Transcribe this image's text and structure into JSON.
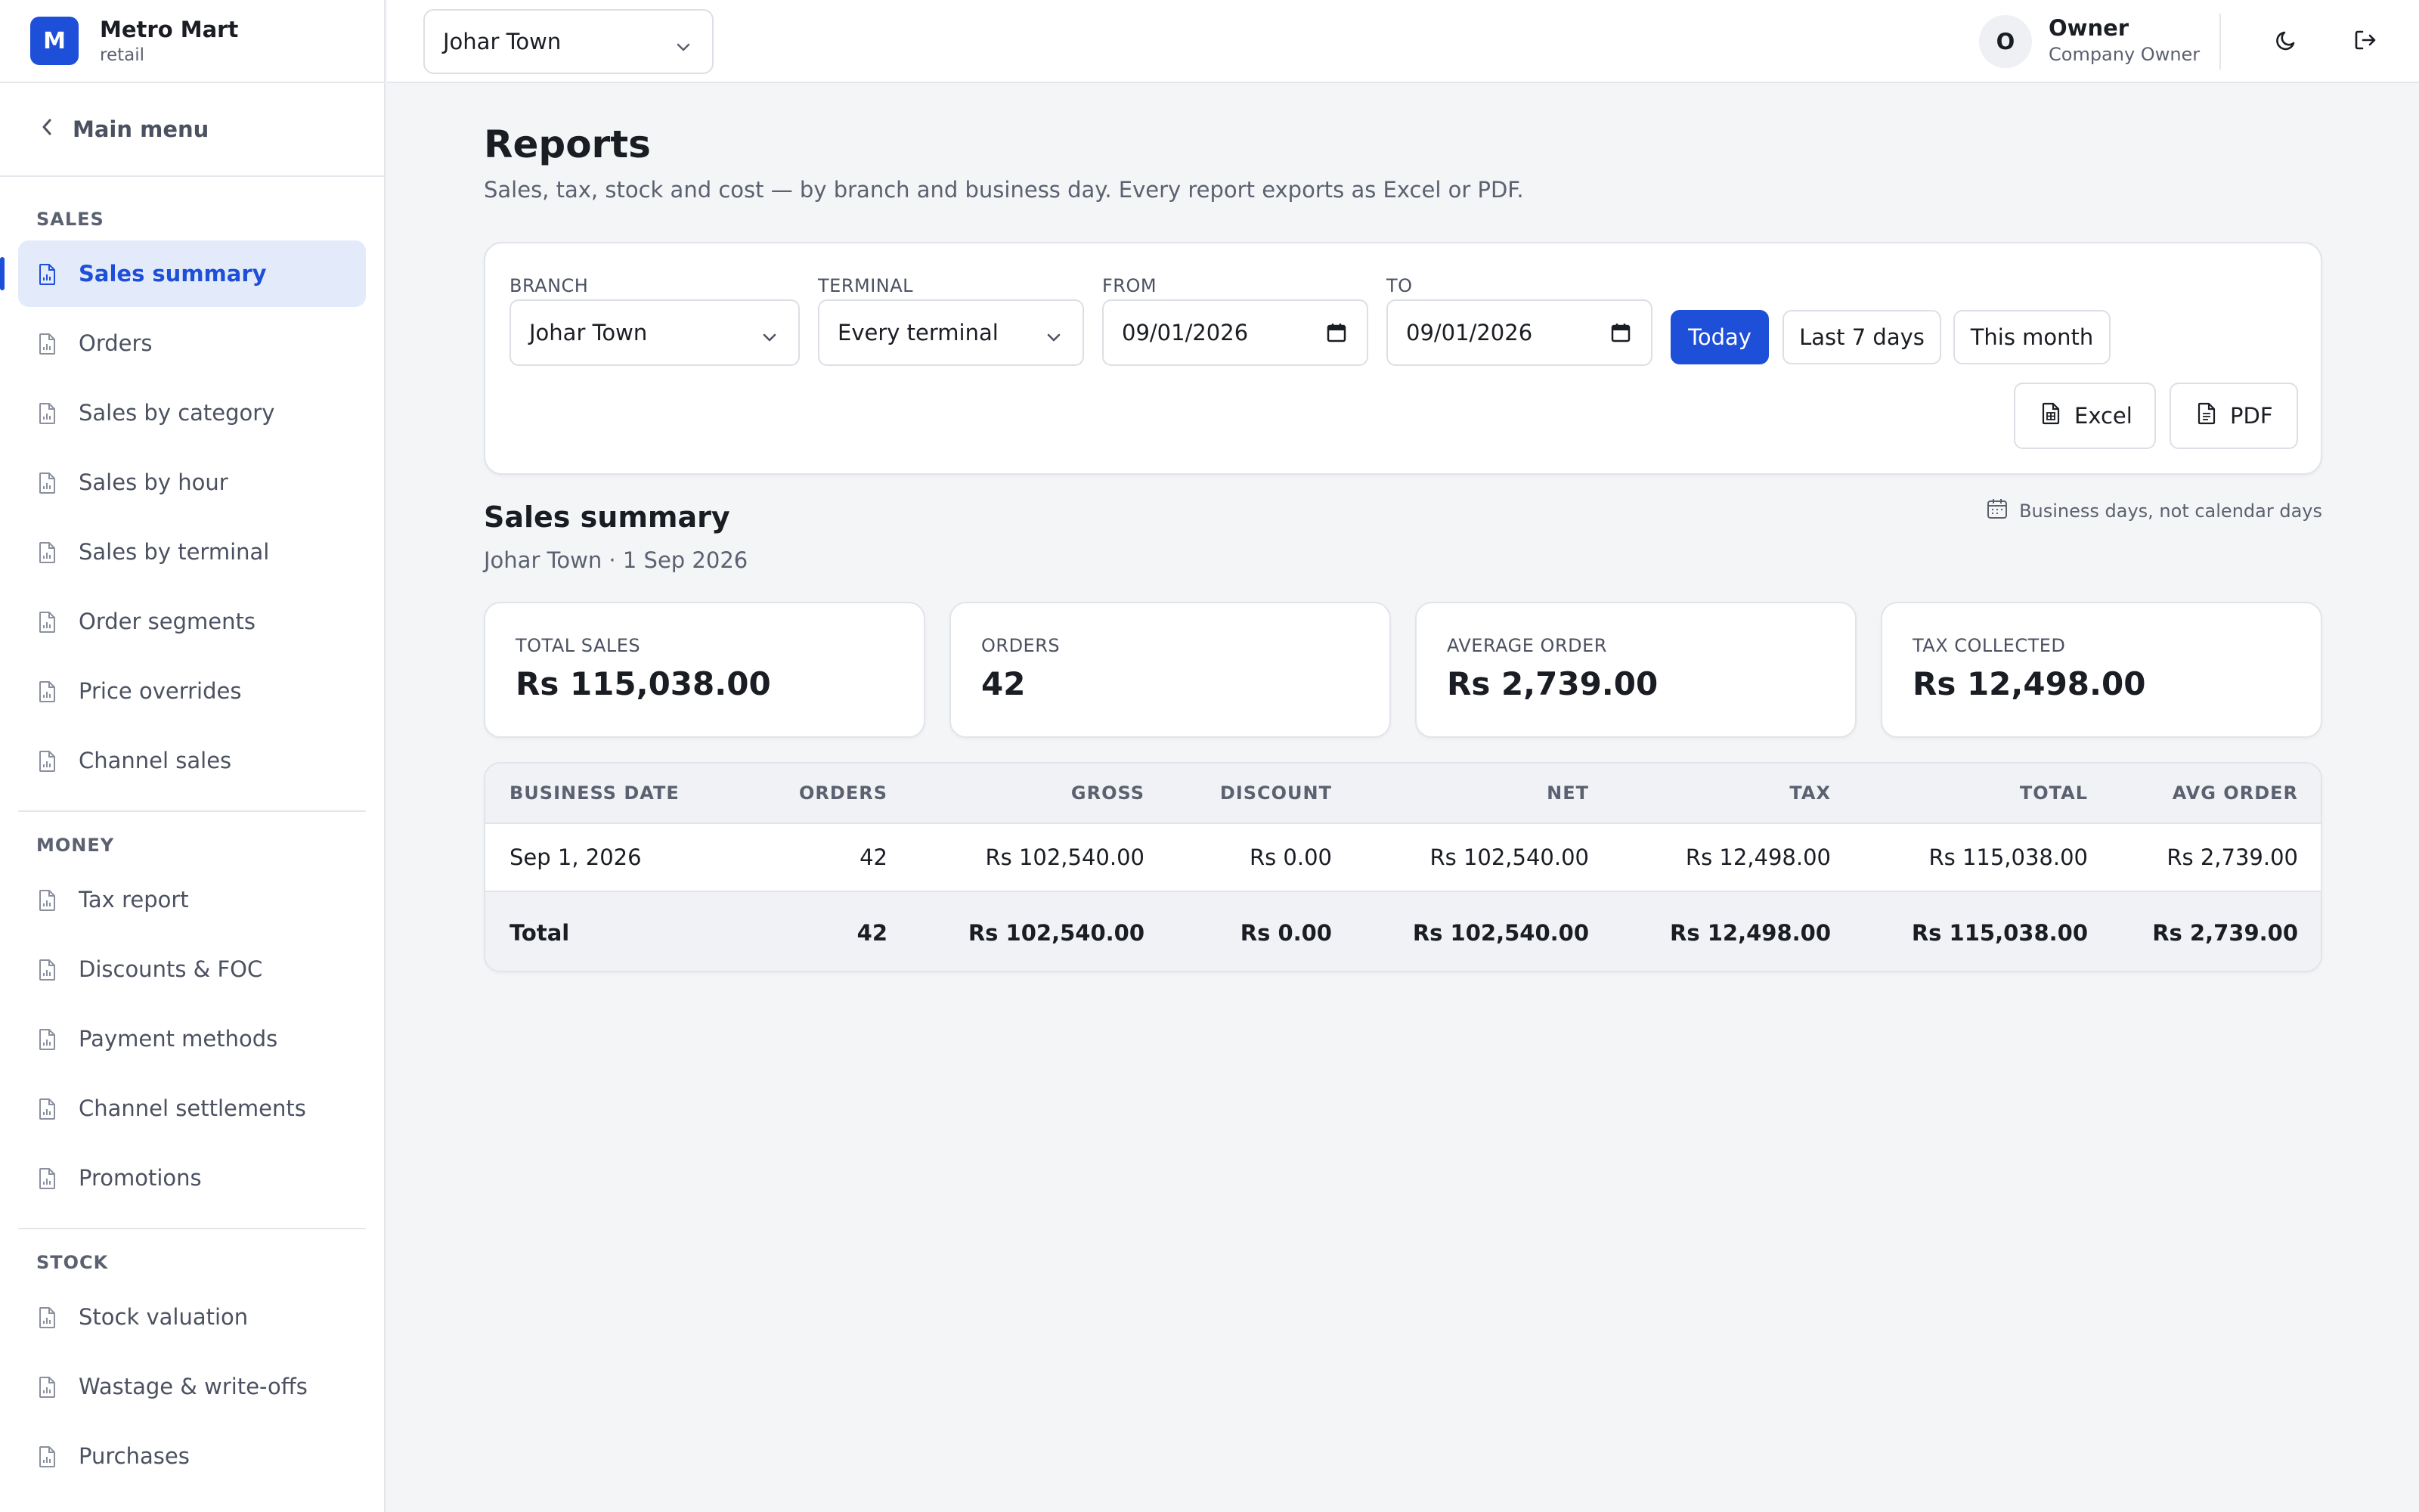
{
  "brand": {
    "logo_letter": "M",
    "name": "Metro Mart",
    "type": "retail"
  },
  "topbar": {
    "branch": "Johar Town",
    "user_initial": "O",
    "user_name": "Owner",
    "user_role": "Company Owner",
    "icons": [
      "moon-icon",
      "logout-icon"
    ]
  },
  "sidebar": {
    "back_label": "Main menu",
    "sections": [
      {
        "title": "SALES",
        "items": [
          "Sales summary",
          "Orders",
          "Sales by category",
          "Sales by hour",
          "Sales by terminal",
          "Order segments",
          "Price overrides",
          "Channel sales"
        ]
      },
      {
        "title": "MONEY",
        "items": [
          "Tax report",
          "Discounts & FOC",
          "Payment methods",
          "Channel settlements",
          "Promotions"
        ]
      },
      {
        "title": "STOCK",
        "items": [
          "Stock valuation",
          "Wastage & write-offs",
          "Purchases"
        ]
      }
    ],
    "active_item": "Sales summary"
  },
  "page": {
    "title": "Reports",
    "subtitle": "Sales, tax, stock and cost — by branch and business day. Every report exports as Excel or PDF."
  },
  "filters": {
    "branch_label": "BRANCH",
    "branch_value": "Johar Town",
    "terminal_label": "TERMINAL",
    "terminal_value": "Every terminal",
    "from_label": "FROM",
    "from_value": "09/01/2026",
    "to_label": "TO",
    "to_value": "09/01/2026",
    "quick_ranges": [
      "Today",
      "Last 7 days",
      "This month"
    ],
    "active_range": "Today",
    "export_excel": "Excel",
    "export_pdf": "PDF"
  },
  "report": {
    "title": "Sales summary",
    "subtitle": "Johar Town · 1 Sep 2026",
    "note": "Business days, not calendar days"
  },
  "stats": [
    {
      "label": "TOTAL SALES",
      "value": "Rs 115,038.00"
    },
    {
      "label": "ORDERS",
      "value": "42"
    },
    {
      "label": "AVERAGE ORDER",
      "value": "Rs 2,739.00"
    },
    {
      "label": "TAX COLLECTED",
      "value": "Rs 12,498.00"
    }
  ],
  "table": {
    "headers": [
      "BUSINESS DATE",
      "ORDERS",
      "GROSS",
      "DISCOUNT",
      "NET",
      "TAX",
      "TOTAL",
      "AVG ORDER"
    ],
    "rows": [
      [
        "Sep 1, 2026",
        "42",
        "Rs 102,540.00",
        "Rs 0.00",
        "Rs 102,540.00",
        "Rs 12,498.00",
        "Rs 115,038.00",
        "Rs 2,739.00"
      ]
    ],
    "footer": [
      "Total",
      "42",
      "Rs 102,540.00",
      "Rs 0.00",
      "Rs 102,540.00",
      "Rs 12,498.00",
      "Rs 115,038.00",
      "Rs 2,739.00"
    ]
  },
  "colors": {
    "accent": "#1d4fd8",
    "active_bg": "#e3ebfb",
    "page_bg": "#f4f5f7"
  }
}
